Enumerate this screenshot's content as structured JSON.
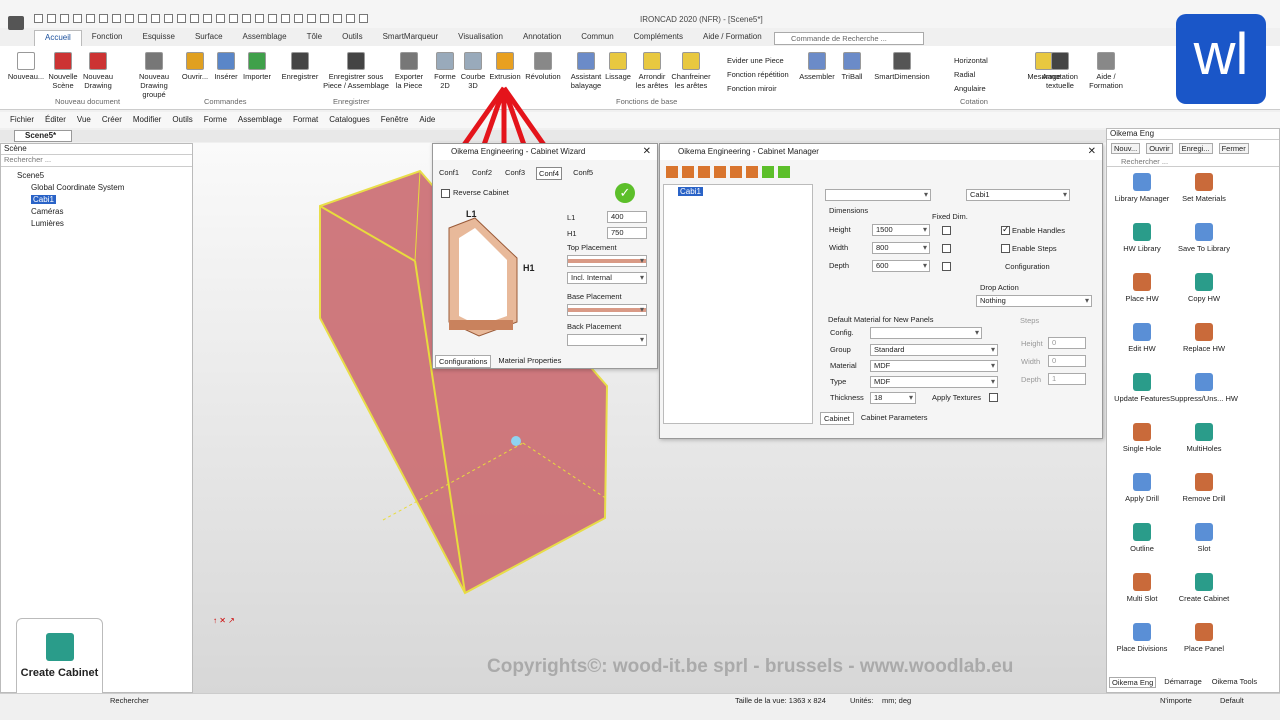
{
  "app": {
    "title": "IRONCAD 2020 (NFR) - [Scene5*]"
  },
  "ribbon_tabs": [
    "Accueil",
    "Fonction",
    "Esquisse",
    "Surface",
    "Assemblage",
    "Tôle",
    "Outils",
    "SmartMarqueur",
    "Visualisation",
    "Annotation",
    "Commun",
    "Compléments",
    "Aide / Formation"
  ],
  "search_cmd": "Commande de Recherche ...",
  "ribbon": {
    "buttons": [
      "Nouveau...",
      "Nouvelle Scène",
      "Nouveau Drawing",
      "Nouveau Drawing groupé",
      "Ouvrir...",
      "Insérer",
      "Importer",
      "Enregistrer",
      "Enregistrer sous Piece / Assemblage",
      "Exporter la Piece",
      "Forme 2D",
      "Courbe 3D",
      "Extrusion",
      "Révolution",
      "Assistant balayage",
      "Lissage",
      "Arrondir les arêtes",
      "Chanfreiner les arêtes",
      "Assembler",
      "TriBall",
      "SmartDimension",
      "Mesurage",
      "Annotation textuelle",
      "Aide / Formation"
    ],
    "small": [
      "Evider une Piece",
      "Fonction répétition",
      "Fonction miroir",
      "Horizontal",
      "Radial",
      "Angulaire"
    ],
    "groups": [
      "Nouveau document",
      "Commandes",
      "Enregistrer",
      "Fonctions de base",
      "Cotation"
    ]
  },
  "menu": [
    "Fichier",
    "Éditer",
    "Vue",
    "Créer",
    "Modifier",
    "Outils",
    "Forme",
    "Assemblage",
    "Format",
    "Catalogues",
    "Fenêtre",
    "Aide"
  ],
  "doc_tab": "Scene5*",
  "scene_panel": {
    "title": "Scène",
    "search": "Rechercher ...",
    "tree": [
      "Scene5",
      "Global Coordinate System",
      "Cabi1",
      "Caméras",
      "Lumières"
    ]
  },
  "wizard": {
    "title": "Oikema Engineering - Cabinet Wizard",
    "confs": [
      "Conf1",
      "Conf2",
      "Conf3",
      "Conf4",
      "Conf5"
    ],
    "reverse": "Reverse Cabinet",
    "L1": "400",
    "H1": "750",
    "labels": {
      "l1": "L1",
      "h1": "H1",
      "top": "Top Placement",
      "incl": "Incl. Internal",
      "base": "Base Placement",
      "back": "Back Placement"
    },
    "tabs": [
      "Configurations",
      "Material Properties"
    ],
    "img_l1": "L1",
    "img_h1": "H1"
  },
  "manager": {
    "title": "Oikema Engineering - Cabinet Manager",
    "tree_item": "Cabi1",
    "name": "Cabi1",
    "dimensions": "Dimensions",
    "fixed": "Fixed Dim.",
    "height_l": "Height",
    "height": "1500",
    "width_l": "Width",
    "width": "800",
    "depth_l": "Depth",
    "depth": "600",
    "handles": "Enable Handles",
    "steps": "Enable Steps",
    "config": "Configuration",
    "drop": "Drop Action",
    "drop_val": "Nothing",
    "default_mat": "Default Material for New Panels",
    "config_l": "Config.",
    "group_l": "Group",
    "group": "Standard",
    "material_l": "Material",
    "material": "MDF",
    "type_l": "Type",
    "type": "MDF",
    "thick_l": "Thickness",
    "thick": "18",
    "apply": "Apply Textures",
    "steps_grp": "Steps",
    "s_h": "Height",
    "s_w": "Width",
    "s_d": "Depth",
    "s_hv": "0",
    "s_wv": "0",
    "s_dv": "1",
    "tabs": [
      "Cabinet",
      "Cabinet Parameters"
    ]
  },
  "right_panel": {
    "title": "Oikema Eng",
    "top": [
      "Nouv...",
      "Ouvrir",
      "Enregi...",
      "Fermer"
    ],
    "search": "Rechercher ...",
    "tools": [
      "Library Manager",
      "Set Materials",
      "HW Library",
      "Save To Library",
      "Place HW",
      "Copy HW",
      "Edit HW",
      "Replace HW",
      "Update Features",
      "Suppress/Uns... HW",
      "Single Hole",
      "MultiHoles",
      "Apply Drill",
      "Remove Drill",
      "Outline",
      "Slot",
      "Multi Slot",
      "Create Cabinet",
      "Place Divisions",
      "Place Panel"
    ],
    "tabs": [
      "Oikema Eng",
      "Démarrage",
      "Oikema Tools"
    ]
  },
  "overlay": {
    "create_cabinet": "Create Cabinet",
    "copyright": "Copyrights©: wood-it.be sprl - brussels - www.woodlab.eu",
    "logo": "wl"
  },
  "status": {
    "search": "Rechercher",
    "size": "Taille de la vue: 1363 x 824",
    "units_l": "Unités:",
    "units": "mm; deg",
    "any": "N'importe",
    "default": "Default"
  }
}
